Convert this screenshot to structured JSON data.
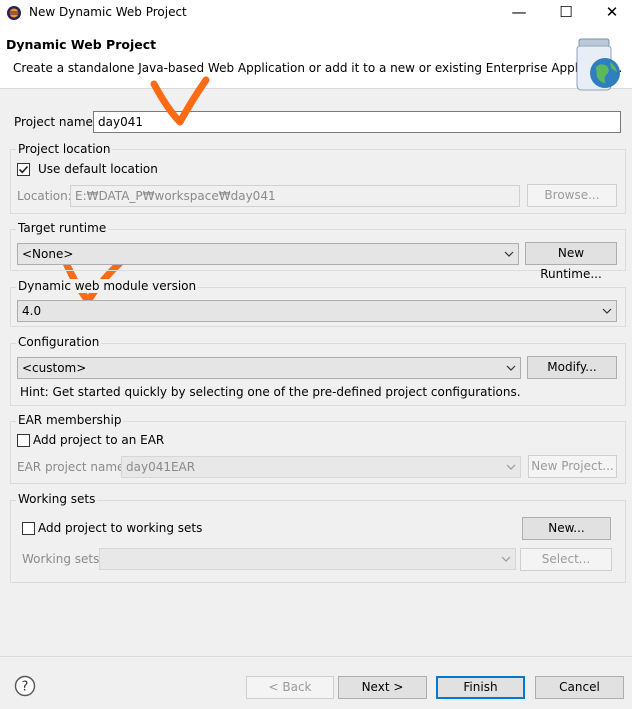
{
  "window": {
    "title": "New Dynamic Web Project",
    "minimize_glyph": "—",
    "maximize_glyph": "☐",
    "close_glyph": "✕"
  },
  "header": {
    "title": "Dynamic Web Project",
    "description": "Create a standalone Java-based Web Application or add it to a new or existing Enterprise Application."
  },
  "project_name": {
    "label": "Project name:",
    "value": "day041"
  },
  "project_location": {
    "group_label": "Project location",
    "use_default_label": "Use default location",
    "use_default_checked": true,
    "location_label": "Location:",
    "location_value": "E:₩DATA_P₩workspace₩day041",
    "browse_label": "Browse..."
  },
  "target_runtime": {
    "group_label": "Target runtime",
    "selected": "<None>",
    "new_runtime_label": "New Runtime..."
  },
  "module_version": {
    "group_label": "Dynamic web module version",
    "selected": "4.0"
  },
  "configuration": {
    "group_label": "Configuration",
    "selected": "<custom>",
    "modify_label": "Modify...",
    "hint": "Hint: Get started quickly by selecting one of the pre-defined project configurations."
  },
  "ear": {
    "group_label": "EAR membership",
    "add_label": "Add project to an EAR",
    "add_checked": false,
    "project_name_label": "EAR project name:",
    "project_name_value": "day041EAR",
    "new_project_label": "New Project..."
  },
  "working_sets": {
    "group_label": "Working sets",
    "add_label": "Add project to working sets",
    "add_checked": false,
    "new_label": "New...",
    "sets_label": "Working sets:",
    "sets_value": "",
    "select_label": "Select..."
  },
  "footer": {
    "back_label": "< Back",
    "next_label": "Next >",
    "finish_label": "Finish",
    "cancel_label": "Cancel"
  },
  "colors": {
    "annotation": "#ff6a13",
    "primary_border": "#0078d7"
  },
  "icons": [
    "eclipse-icon",
    "jar-globe-icon",
    "help-icon",
    "chevron-down-icon",
    "checkmark-icon"
  ]
}
